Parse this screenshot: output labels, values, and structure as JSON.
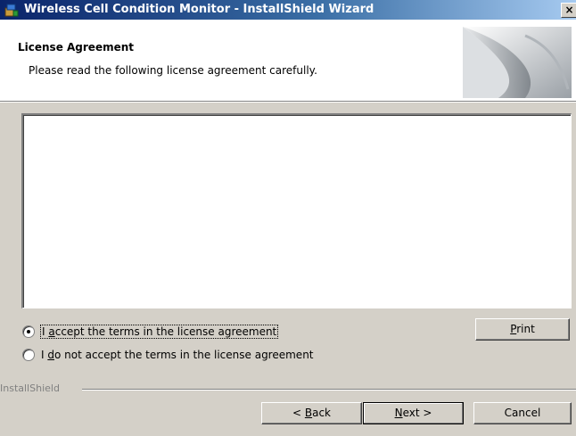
{
  "window": {
    "title": "Wireless Cell Condition Monitor - InstallShield Wizard",
    "close_glyph": "×",
    "title_gradient": [
      "#0a246a",
      "#a6caf0"
    ]
  },
  "header": {
    "heading": "License Agreement",
    "subheading": "Please read the following license agreement carefully."
  },
  "license": {
    "text": ""
  },
  "options": {
    "accept": {
      "pre": "I ",
      "mnemonic": "a",
      "post": "ccept the terms in the license agreement",
      "selected": true
    },
    "decline": {
      "pre": "I ",
      "mnemonic": "d",
      "post": "o not accept the terms in the license agreement",
      "selected": false
    }
  },
  "buttons": {
    "print": {
      "mnemonic": "P",
      "post": "rint"
    },
    "back": {
      "pre": "< ",
      "mnemonic": "B",
      "post": "ack"
    },
    "next": {
      "mnemonic": "N",
      "post": "ext >"
    },
    "cancel": {
      "label": "Cancel"
    }
  },
  "footer": {
    "brand": "InstallShield"
  },
  "icons": {
    "app": "installer-icon",
    "close": "close-icon",
    "banner": "page-curl-graphic"
  }
}
